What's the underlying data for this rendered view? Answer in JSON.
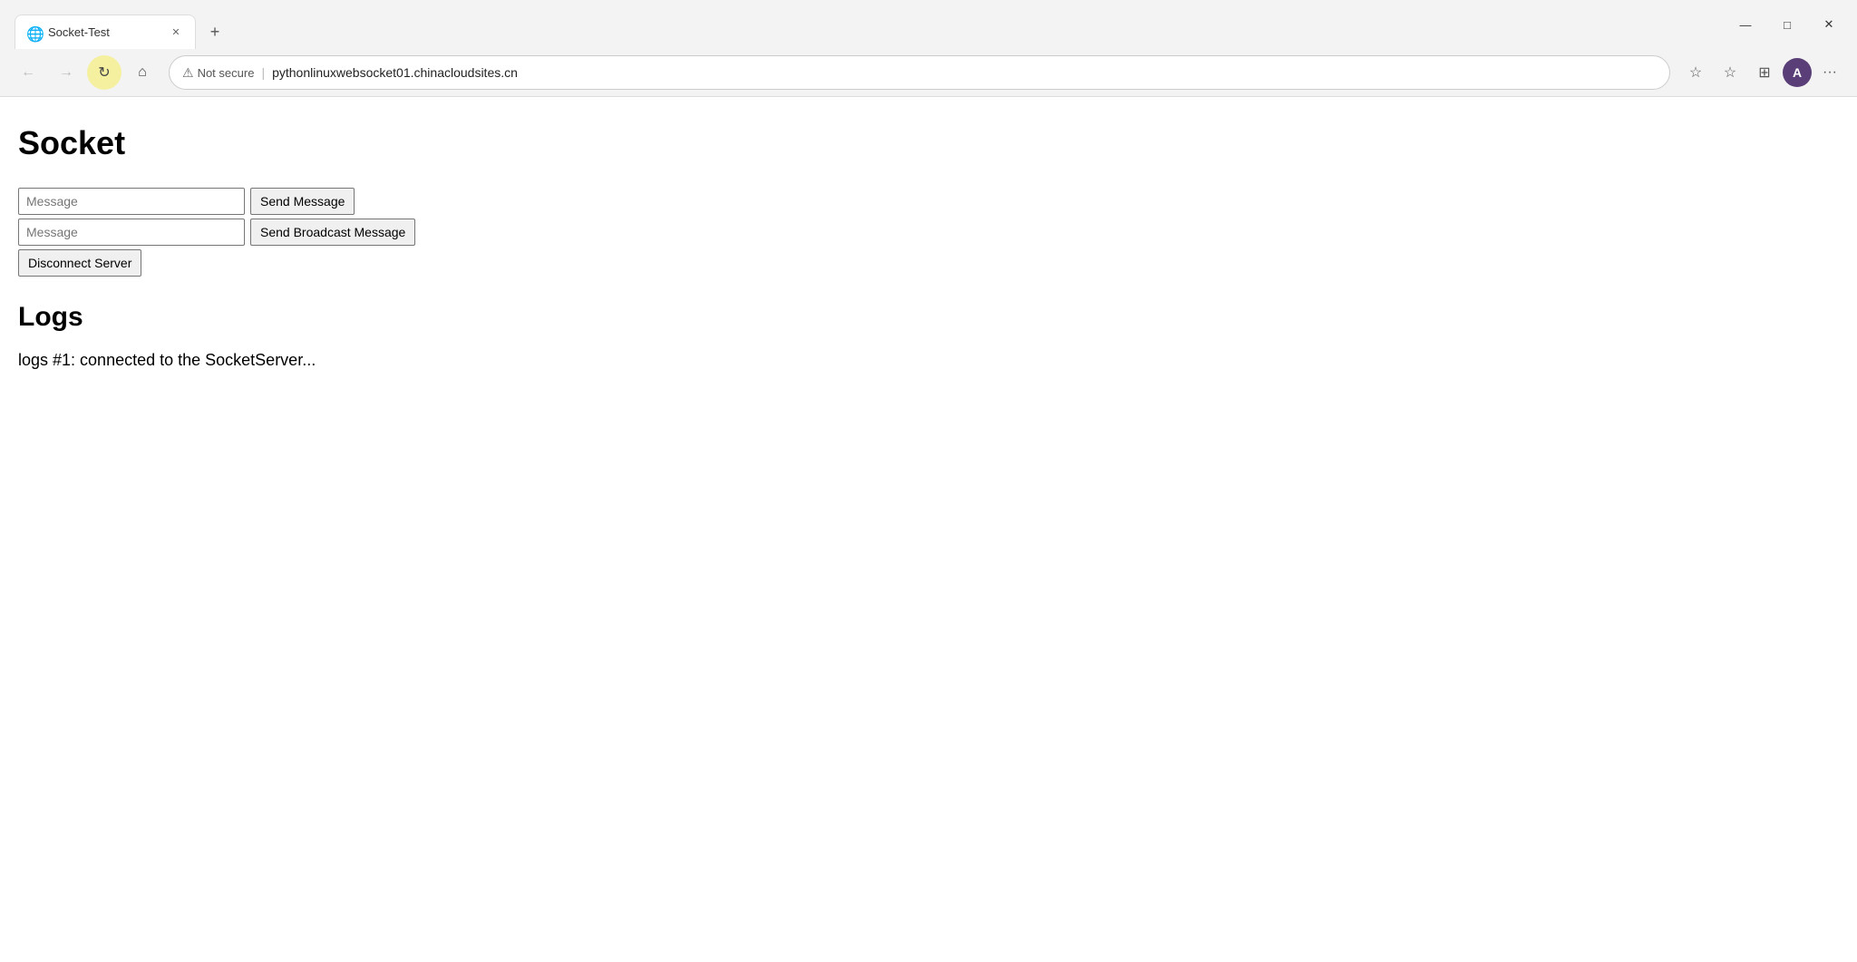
{
  "browser": {
    "tab": {
      "title": "Socket-Test",
      "favicon": "📄"
    },
    "new_tab_label": "+",
    "window_controls": {
      "minimize": "—",
      "maximize": "□",
      "close": "✕"
    },
    "nav": {
      "back": "←",
      "forward": "→",
      "refresh": "↻",
      "home": "⌂",
      "not_secure_label": "Not secure",
      "url": "pythonlinuxwebsocket01.chinacloudsites.cn",
      "add_favorite": "☆",
      "favorites": "☆",
      "collections": "⊞",
      "profile": "A",
      "more": "···"
    }
  },
  "page": {
    "title": "Socket",
    "message_input_1_placeholder": "Message",
    "message_input_2_placeholder": "Message",
    "send_message_label": "Send Message",
    "send_broadcast_label": "Send Broadcast Message",
    "disconnect_label": "Disconnect Server",
    "logs_title": "Logs",
    "log_entry": "logs #1: connected to the SocketServer..."
  }
}
